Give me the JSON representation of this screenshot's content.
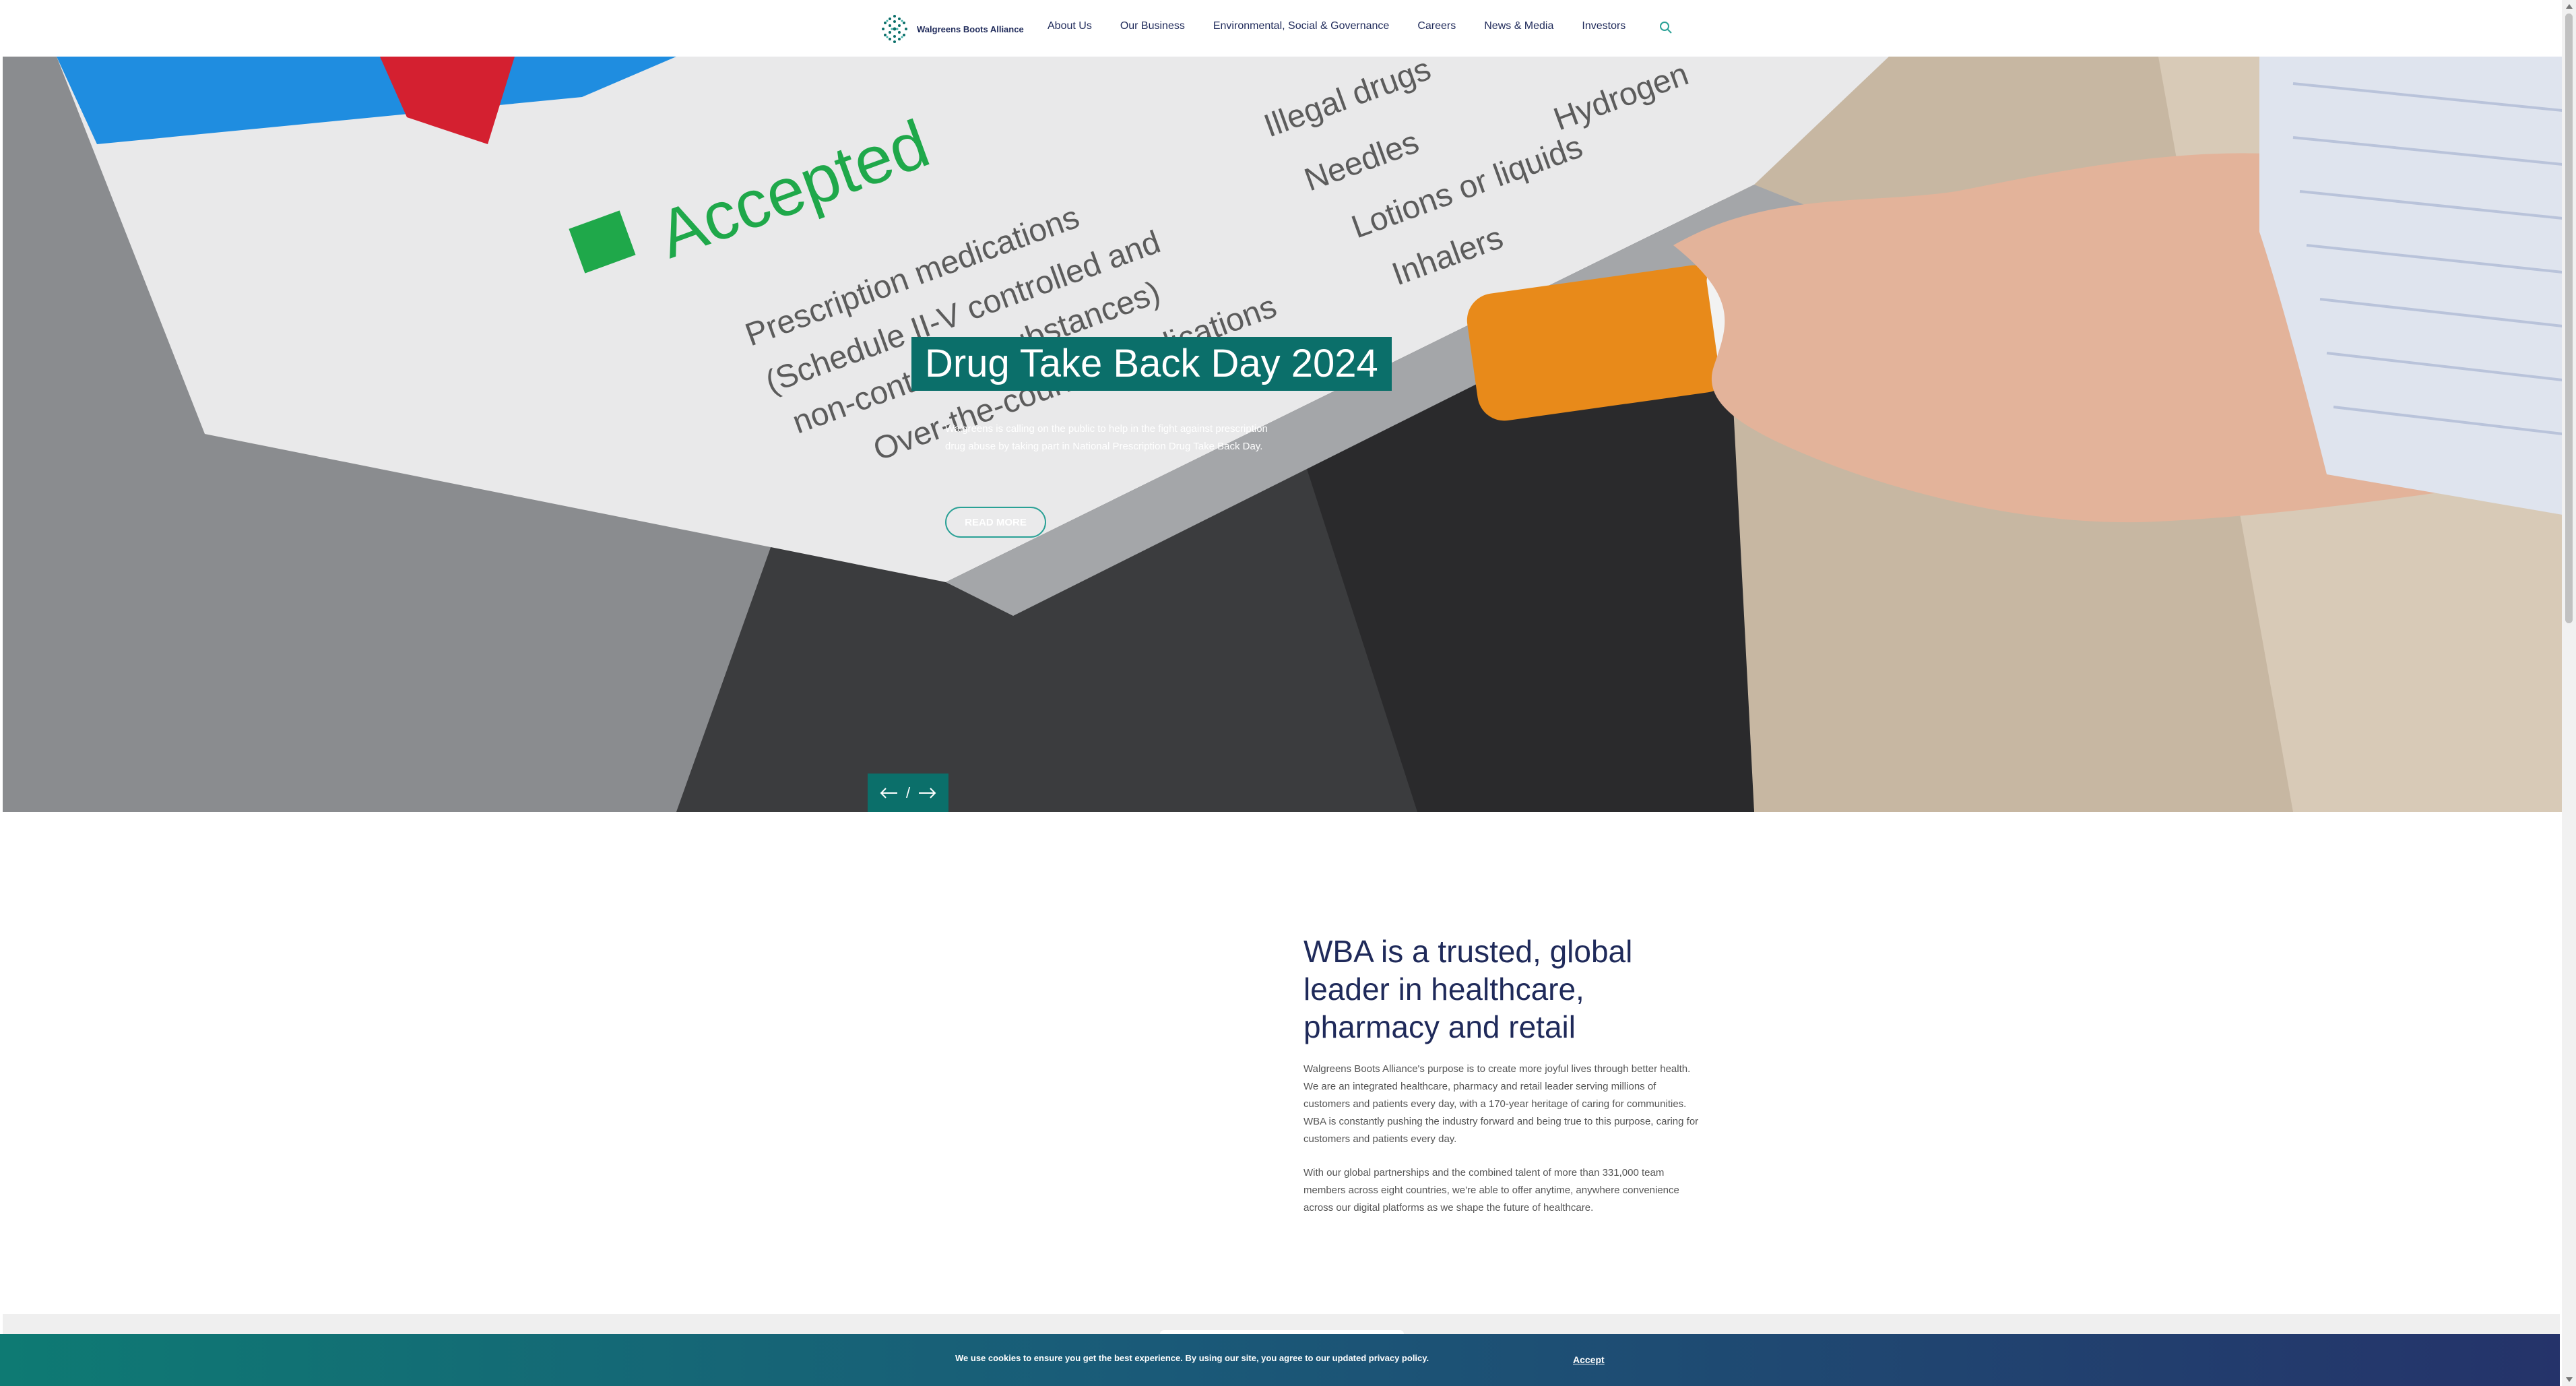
{
  "header": {
    "logo_text": "Walgreens Boots Alliance",
    "nav": [
      "About Us",
      "Our Business",
      "Environmental, Social & Governance",
      "Careers",
      "News & Media",
      "Investors"
    ],
    "search_icon": "search-icon"
  },
  "hero": {
    "title": "Drug Take Back Day 2024",
    "description": "Walgreens is calling on the public to help in the fight against prescription drug abuse by taking part in National Prescription Drug Take Back Day.",
    "button_label": "READ MORE",
    "slider_separator": "/",
    "prev_icon": "arrow-left-icon",
    "next_icon": "arrow-right-icon",
    "image_text": {
      "accepted": "Accepted",
      "accepted_items": [
        "Prescription medications",
        "(Schedule II-V controlled and",
        "non-controlled substances)",
        "Over-the-counter medications"
      ],
      "rejected_items": [
        "Illegal drugs",
        "Needles",
        "Lotions or liquids",
        "Inhalers",
        "Hydrogen"
      ]
    }
  },
  "intro": {
    "heading": "WBA is a trusted, global leader in healthcare, pharmacy and retail",
    "paragraph1": "Walgreens Boots Alliance's purpose is to create more joyful lives through better health. We are an integrated healthcare, pharmacy and retail leader serving millions of customers and patients every day, with a 170-year heritage of caring for communities. WBA is constantly pushing the industry forward and being true to this purpose, caring for customers and patients every day.",
    "paragraph2": "With our global partnerships and the combined talent of more than 331,000 team members across eight countries, we're able to offer anytime, anywhere convenience across our digital platforms as we shape the future of healthcare."
  },
  "cookie": {
    "text": "We use cookies to ensure you get the best experience. By using our site, you agree to our updated privacy policy.",
    "accept_label": "Accept"
  },
  "colors": {
    "brand_teal": "#0b6f6a",
    "navy": "#1f2a5a",
    "accent_teal": "#2aa196"
  }
}
